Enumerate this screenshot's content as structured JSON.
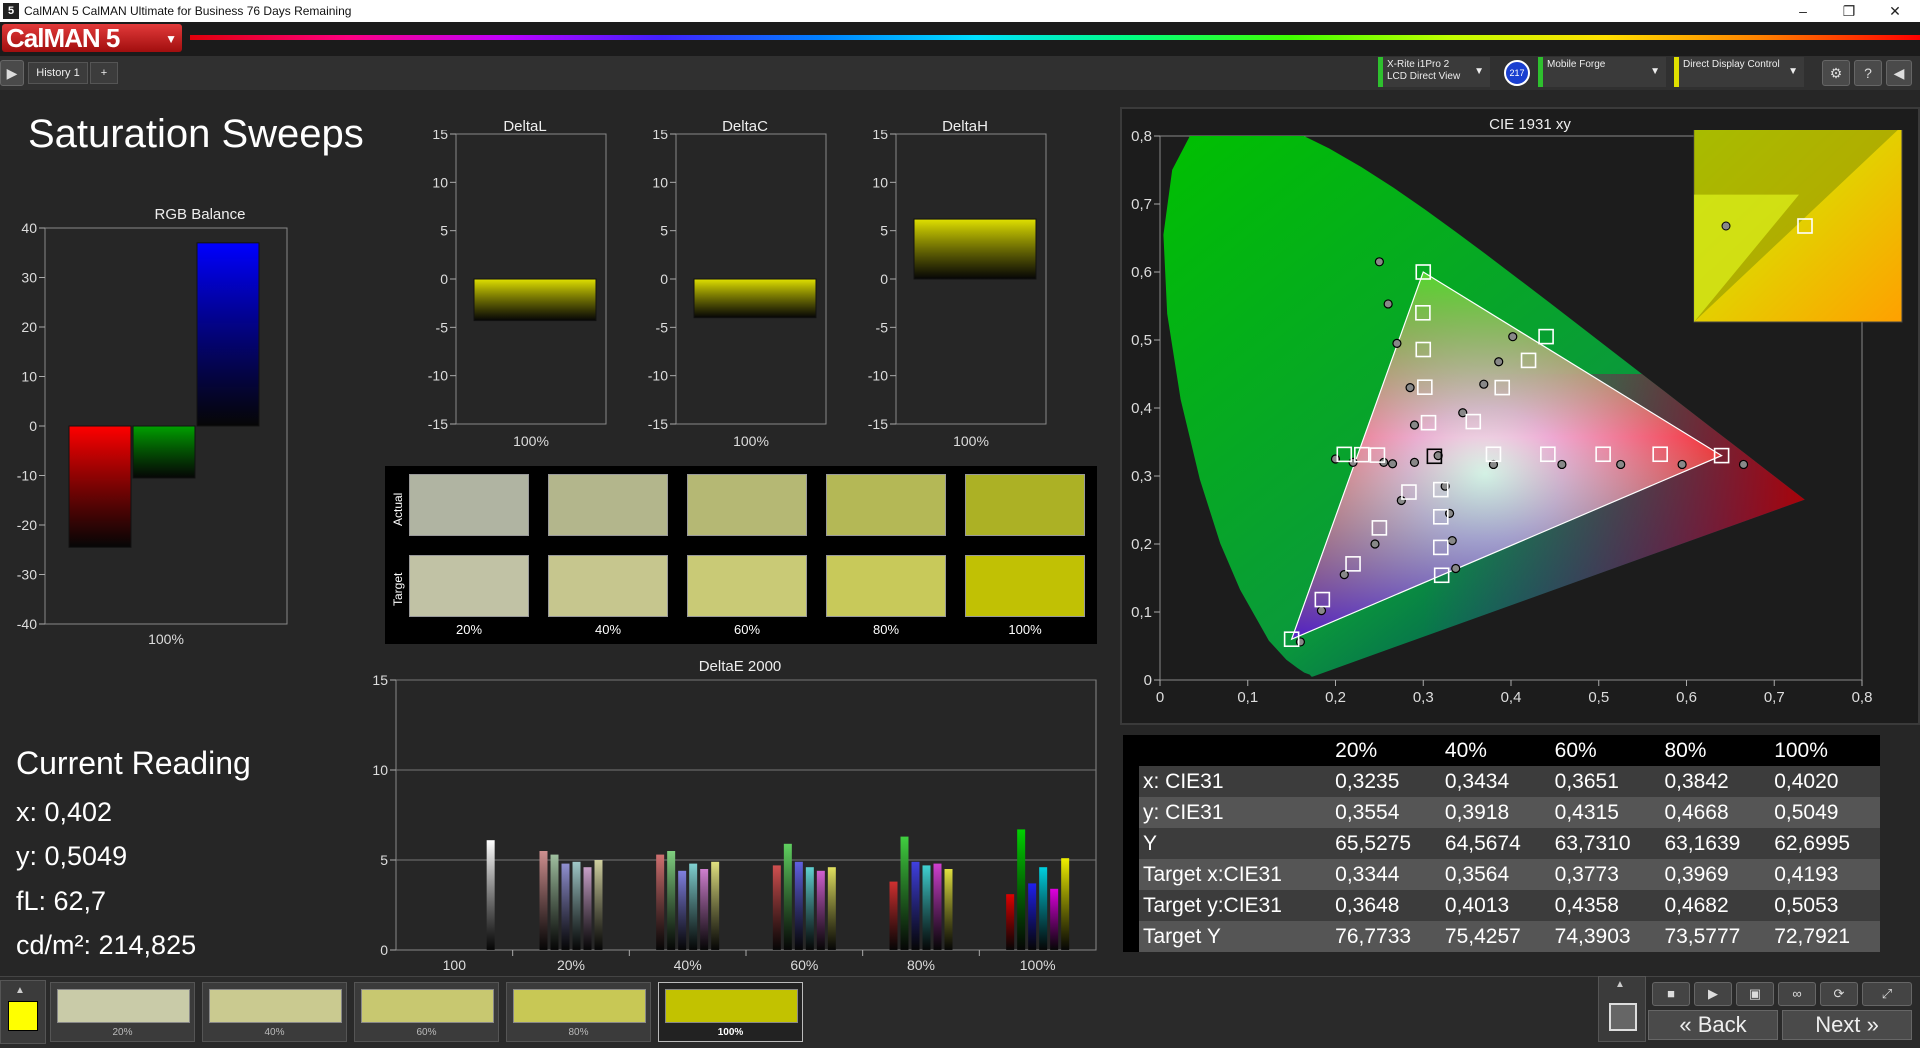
{
  "window": {
    "title": "CalMAN 5 CalMAN Ultimate for Business 76 Days Remaining",
    "minimize": "–",
    "restore": "❐",
    "close": "✕"
  },
  "toolbar": {
    "logo": "CalMAN 5",
    "devices": [
      {
        "line1": "X-Rite i1Pro 2",
        "line2": "LCD Direct View",
        "accent": "#2ec02e"
      },
      {
        "line1": "Mobile Forge",
        "line2": "",
        "accent": "#2ec02e"
      },
      {
        "line1": "Direct Display Control",
        "line2": "",
        "accent": "#e0e000"
      }
    ],
    "device_badge": "217"
  },
  "tabs": {
    "history": "History 1",
    "add": "+"
  },
  "page": {
    "title": "Saturation Sweeps"
  },
  "rgb_balance": {
    "chart_data": {
      "type": "bar",
      "title": "RGB Balance",
      "categories": [
        "100%"
      ],
      "series": [
        {
          "color": "#ff0000",
          "values": [
            -24.5
          ]
        },
        {
          "color": "#00a000",
          "values": [
            -10.5
          ]
        },
        {
          "color": "#0000ff",
          "values": [
            37
          ]
        }
      ],
      "ylim": [
        -40,
        40
      ],
      "yticks": [
        "40",
        "30",
        "20",
        "10",
        "0",
        "-10",
        "-20",
        "-30",
        "-40"
      ]
    }
  },
  "delta_charts": [
    {
      "chart_data": {
        "type": "bar",
        "title": "DeltaL",
        "categories": [
          "100%"
        ],
        "values": [
          -4.3
        ],
        "ylim": [
          -15,
          15
        ],
        "yticks": [
          "15",
          "10",
          "5",
          "0",
          "-5",
          "-10",
          "-15"
        ]
      }
    },
    {
      "chart_data": {
        "type": "bar",
        "title": "DeltaC",
        "categories": [
          "100%"
        ],
        "values": [
          -4.0
        ],
        "ylim": [
          -15,
          15
        ],
        "yticks": [
          "15",
          "10",
          "5",
          "0",
          "-5",
          "-10",
          "-15"
        ]
      }
    },
    {
      "chart_data": {
        "type": "bar",
        "title": "DeltaH",
        "categories": [
          "100%"
        ],
        "values": [
          6.2
        ],
        "ylim": [
          -15,
          15
        ],
        "yticks": [
          "15",
          "10",
          "5",
          "0",
          "-5",
          "-10",
          "-15"
        ]
      }
    }
  ],
  "swatches": {
    "row_labels": {
      "actual": "Actual",
      "target": "Target"
    },
    "labels": [
      "20%",
      "40%",
      "60%",
      "80%",
      "100%"
    ],
    "actual": [
      "#b0b4a2",
      "#b3b68c",
      "#b5b874",
      "#b4b856",
      "#acb125"
    ],
    "target": [
      "#c1c2a5",
      "#c6c68e",
      "#c9ca76",
      "#c8c95a",
      "#c1c104"
    ]
  },
  "delta_e": {
    "chart_data": {
      "type": "bar",
      "title": "DeltaE 2000",
      "categories": [
        "100",
        "20%",
        "40%",
        "60%",
        "80%",
        "100%"
      ],
      "groups": [
        {
          "values": [
            6.1
          ],
          "colors": [
            "#ffffff"
          ]
        },
        {
          "values": [
            5.5,
            5.3,
            4.8,
            4.9,
            4.6,
            5.0
          ],
          "colors": [
            "#d09090",
            "#a0c0a0",
            "#9090d0",
            "#a0c8c8",
            "#c8a0c8",
            "#d0d0a0"
          ]
        },
        {
          "values": [
            5.3,
            5.5,
            4.4,
            4.8,
            4.5,
            4.9
          ],
          "colors": [
            "#d07070",
            "#80d080",
            "#8080e0",
            "#80d0d0",
            "#d080d0",
            "#e0e080"
          ]
        },
        {
          "values": [
            4.7,
            5.9,
            4.9,
            4.6,
            4.4,
            4.6
          ],
          "colors": [
            "#d05050",
            "#60d060",
            "#6060e0",
            "#60d0d0",
            "#d060d0",
            "#e0e060"
          ]
        },
        {
          "values": [
            3.8,
            6.3,
            4.9,
            4.7,
            4.8,
            4.5
          ],
          "colors": [
            "#d03030",
            "#40d040",
            "#4040e0",
            "#40d0d0",
            "#d040d0",
            "#e0e040"
          ]
        },
        {
          "values": [
            3.1,
            6.7,
            3.7,
            4.6,
            3.4,
            5.1
          ],
          "colors": [
            "#e00000",
            "#00d000",
            "#2020f0",
            "#00d0e0",
            "#e000e0",
            "#f0f000"
          ]
        }
      ],
      "ylim": [
        0,
        15
      ],
      "yticks": [
        "15",
        "10",
        "5",
        "0"
      ]
    }
  },
  "current_reading": {
    "title": "Current Reading",
    "x": "x: 0,402",
    "y": "y: 0,5049",
    "fl": "fL: 62,7",
    "cdm2": "cd/m²: 214,825"
  },
  "cie": {
    "chart_data": {
      "type": "scatter",
      "title": "CIE 1931 xy",
      "xlim": [
        0,
        0.8
      ],
      "ylim": [
        0,
        0.8
      ],
      "xticks": [
        "0",
        "0,1",
        "0,2",
        "0,3",
        "0,4",
        "0,5",
        "0,6",
        "0,7",
        "0,8"
      ],
      "yticks": [
        "0",
        "0,1",
        "0,2",
        "0,3",
        "0,4",
        "0,5",
        "0,6",
        "0,7",
        "0,8"
      ],
      "gamut": {
        "red": [
          0.64,
          0.33
        ],
        "green": [
          0.3,
          0.6
        ],
        "blue": [
          0.15,
          0.06
        ],
        "white": [
          0.3127,
          0.329
        ]
      },
      "targets": [
        [
          0.2478,
          0.3307
        ],
        [
          0.23,
          0.3314
        ],
        [
          0.21,
          0.3318
        ],
        [
          0.306,
          0.3784
        ],
        [
          0.3018,
          0.4306
        ],
        [
          0.3,
          0.486
        ],
        [
          0.2996,
          0.54
        ],
        [
          0.3,
          0.6
        ],
        [
          0.2837,
          0.2764
        ],
        [
          0.25,
          0.2237
        ],
        [
          0.22,
          0.1708
        ],
        [
          0.185,
          0.1183
        ],
        [
          0.15,
          0.06
        ],
        [
          0.357,
          0.38
        ],
        [
          0.39,
          0.43
        ],
        [
          0.42,
          0.47
        ],
        [
          0.44,
          0.505
        ],
        [
          0.38,
          0.332
        ],
        [
          0.442,
          0.332
        ],
        [
          0.505,
          0.332
        ],
        [
          0.57,
          0.332
        ],
        [
          0.64,
          0.33
        ],
        [
          0.32,
          0.28
        ],
        [
          0.32,
          0.24
        ],
        [
          0.32,
          0.195
        ],
        [
          0.321,
          0.154
        ],
        [
          0.3127,
          0.329
        ]
      ],
      "actuals": [
        [
          0.29,
          0.32
        ],
        [
          0.265,
          0.318
        ],
        [
          0.255,
          0.32
        ],
        [
          0.22,
          0.32
        ],
        [
          0.2,
          0.325
        ],
        [
          0.29,
          0.375
        ],
        [
          0.285,
          0.43
        ],
        [
          0.27,
          0.495
        ],
        [
          0.26,
          0.553
        ],
        [
          0.25,
          0.615
        ],
        [
          0.275,
          0.264
        ],
        [
          0.245,
          0.2
        ],
        [
          0.21,
          0.155
        ],
        [
          0.184,
          0.102
        ],
        [
          0.16,
          0.056
        ],
        [
          0.345,
          0.393
        ],
        [
          0.369,
          0.435
        ],
        [
          0.386,
          0.468
        ],
        [
          0.402,
          0.5049
        ],
        [
          0.38,
          0.317
        ],
        [
          0.458,
          0.317
        ],
        [
          0.525,
          0.317
        ],
        [
          0.595,
          0.317
        ],
        [
          0.665,
          0.317
        ],
        [
          0.325,
          0.285
        ],
        [
          0.33,
          0.245
        ],
        [
          0.333,
          0.205
        ],
        [
          0.337,
          0.164
        ],
        [
          0.317,
          0.33
        ]
      ],
      "inset": {
        "target": [
          0.4193,
          0.5053
        ],
        "actual": [
          0.402,
          0.5049
        ]
      }
    }
  },
  "data_table": {
    "headers": [
      "",
      "20%",
      "40%",
      "60%",
      "80%",
      "100%"
    ],
    "rows": [
      [
        "x: CIE31",
        "0,3235",
        "0,3434",
        "0,3651",
        "0,3842",
        "0,4020"
      ],
      [
        "y: CIE31",
        "0,3554",
        "0,3918",
        "0,4315",
        "0,4668",
        "0,5049"
      ],
      [
        "Y",
        "65,5275",
        "64,5674",
        "63,7310",
        "63,1639",
        "62,6995"
      ],
      [
        "Target x:CIE31",
        "0,3344",
        "0,3564",
        "0,3773",
        "0,3969",
        "0,4193"
      ],
      [
        "Target y:CIE31",
        "0,3648",
        "0,4013",
        "0,4358",
        "0,4682",
        "0,5053"
      ],
      [
        "Target Y",
        "76,7733",
        "75,4257",
        "74,3903",
        "73,5777",
        "72,7921"
      ]
    ]
  },
  "bottom": {
    "current_color": "#ffff00",
    "swatches": [
      {
        "label": "20%",
        "color": "#c9cba8"
      },
      {
        "label": "40%",
        "color": "#caca90"
      },
      {
        "label": "60%",
        "color": "#c8c870"
      },
      {
        "label": "80%",
        "color": "#c8c855"
      },
      {
        "label": "100%",
        "color": "#c2c200"
      }
    ],
    "back": "Back",
    "next": "Next"
  }
}
